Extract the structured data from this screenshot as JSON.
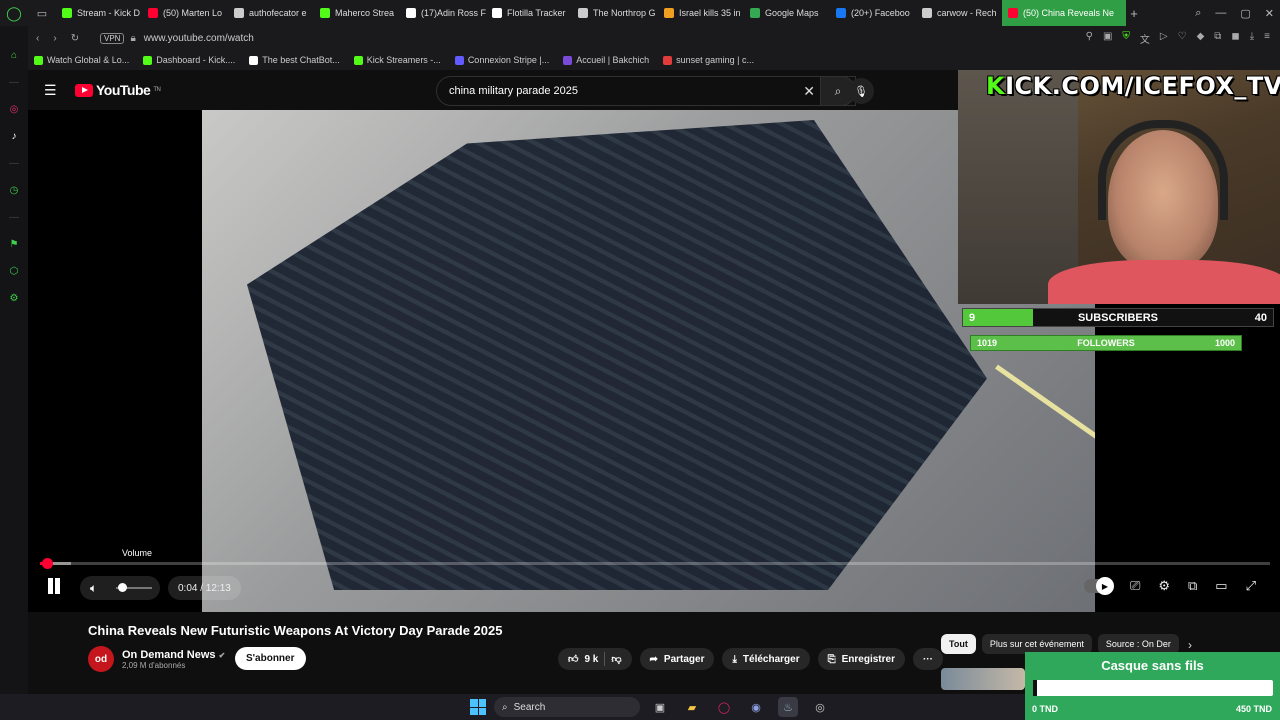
{
  "browser": {
    "tabs": [
      {
        "label": "Stream - Kick D",
        "color": "#53fc18",
        "active": false
      },
      {
        "label": "(50) Marten Lo",
        "color": "#ff0033",
        "active": false
      },
      {
        "label": "authofecator e",
        "color": "#cccccc",
        "active": false
      },
      {
        "label": "Maherco Strea",
        "color": "#53fc18",
        "active": false
      },
      {
        "label": "(17)Adin Ross F",
        "color": "#ffffff",
        "active": false
      },
      {
        "label": "Flotilla Tracker",
        "color": "#ffffff",
        "active": false
      },
      {
        "label": "The Northrop G",
        "color": "#cccccc",
        "active": false
      },
      {
        "label": "Israel kills 35 in",
        "color": "#f0a020",
        "active": false
      },
      {
        "label": "Google Maps",
        "color": "#34a853",
        "active": false
      },
      {
        "label": "(20+) Faceboo",
        "color": "#1877f2",
        "active": false
      },
      {
        "label": "carwow - Rech",
        "color": "#cccccc",
        "active": false
      },
      {
        "label": "(50) China Reveals Ne",
        "color": "#ff0033",
        "active": true
      }
    ],
    "new_tab": "+",
    "vpn": "VPN",
    "url": "www.youtube.com/watch",
    "bookmarks": [
      {
        "label": "Watch Global & Lo...",
        "color": "#53fc18"
      },
      {
        "label": "Dashboard - Kick....",
        "color": "#53fc18"
      },
      {
        "label": "The best ChatBot...",
        "color": "#ffffff"
      },
      {
        "label": "Kick Streamers -...",
        "color": "#53fc18"
      },
      {
        "label": "Connexion Stripe |...",
        "color": "#635bff"
      },
      {
        "label": "Accueil | Bakchich",
        "color": "#7a4bd8"
      },
      {
        "label": "sunset gaming | c...",
        "color": "#e23b3b"
      }
    ]
  },
  "youtube": {
    "logo": "YouTube",
    "logo_suffix": "TN",
    "search_query": "china military parade 2025",
    "player": {
      "current_time": "0:04",
      "duration": "12:13",
      "time_display": "0:04 / 12:13",
      "progress_fraction": 0.0055,
      "buffered_fraction": 0.025,
      "volume_tooltip": "Volume",
      "volume_fraction": 0.05
    },
    "video_title": "China Reveals New Futuristic Weapons At Victory Day Parade 2025",
    "channel": {
      "avatar_text": "od",
      "name": "On Demand News",
      "verified": "✔",
      "subscribers": "2,09 M d'abonnés"
    },
    "subscribe_label": "S'abonner",
    "like_count": "9 k",
    "share_label": "Partager",
    "download_label": "Télécharger",
    "save_label": "Enregistrer",
    "more_label": "···",
    "chips": [
      {
        "label": "Tout",
        "selected": true
      },
      {
        "label": "Plus sur cet événement",
        "selected": false
      },
      {
        "label": "Source : On Der",
        "selected": false
      }
    ]
  },
  "stream_overlay": {
    "kick_prefix": "K",
    "kick_rest": "ICK.COM/ICEFOX_TV",
    "subscribers": {
      "current": "9",
      "label": "SUBSCRIBERS",
      "goal": "40",
      "fraction": 0.225
    },
    "followers": {
      "current": "1019",
      "label": "FOLLOWERS",
      "goal": "1000",
      "fraction": 1.0
    },
    "widget": {
      "title": "Casque sans fils",
      "min": "0 TND",
      "max": "450 TND",
      "fraction": 0.01
    }
  },
  "taskbar": {
    "search_label": "Search"
  },
  "colors": {
    "kick_green": "#53fc18",
    "youtube_red": "#ff0033",
    "tab_active": "#2f9e44"
  }
}
